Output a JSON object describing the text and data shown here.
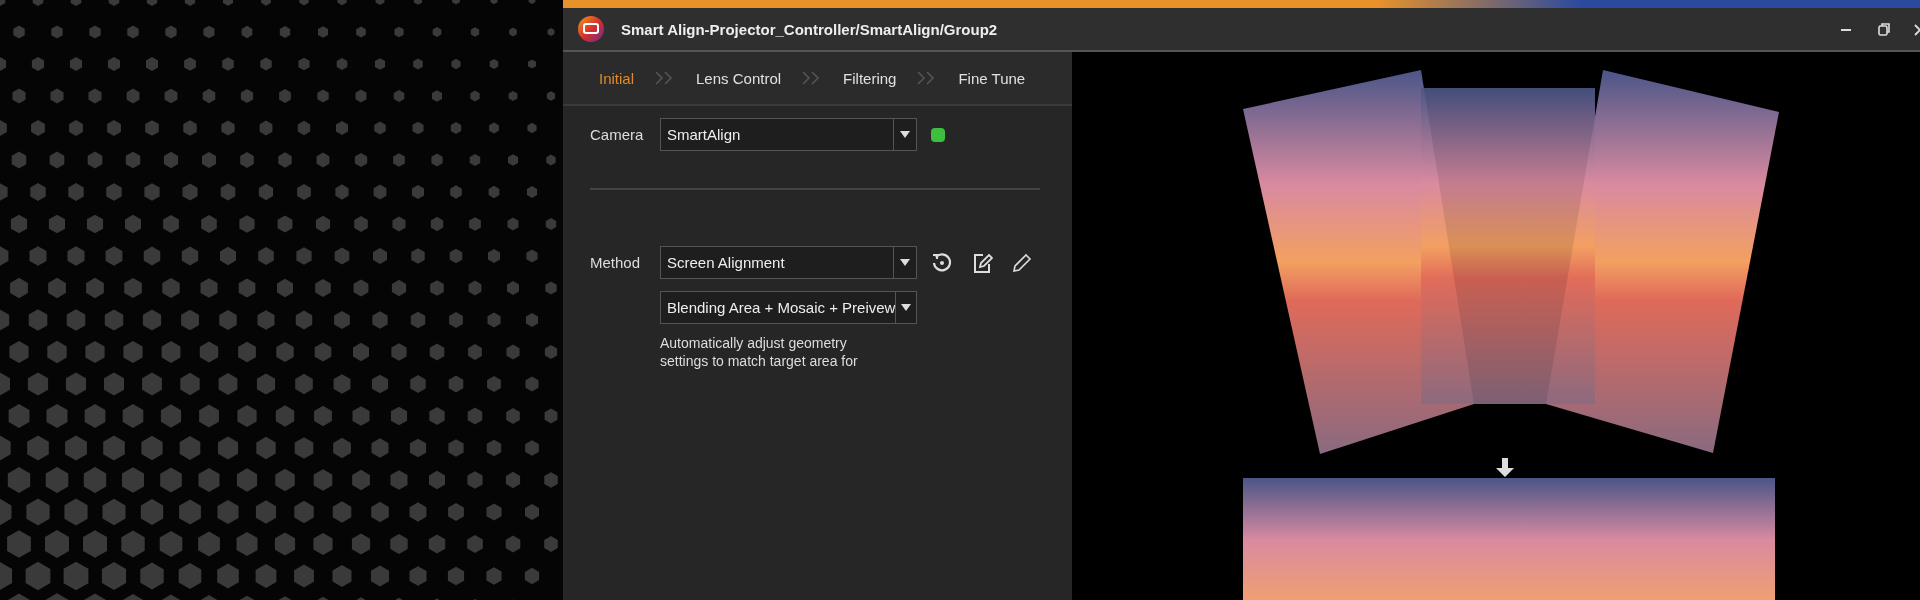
{
  "window": {
    "title": "Smart Align-Projector_Controller/SmartAlign/Group2"
  },
  "tabs": [
    {
      "label": "Initial",
      "selected": true
    },
    {
      "label": "Lens Control",
      "selected": false
    },
    {
      "label": "Filtering",
      "selected": false
    },
    {
      "label": "Fine Tune",
      "selected": false
    }
  ],
  "camera": {
    "label": "Camera",
    "value": "SmartAlign",
    "connected": true
  },
  "method": {
    "label": "Method",
    "value": "Screen Alignment",
    "option": "Blending Area + Mosaic + Preivew",
    "description": "Automatically adjust geometry settings to match target area for"
  }
}
